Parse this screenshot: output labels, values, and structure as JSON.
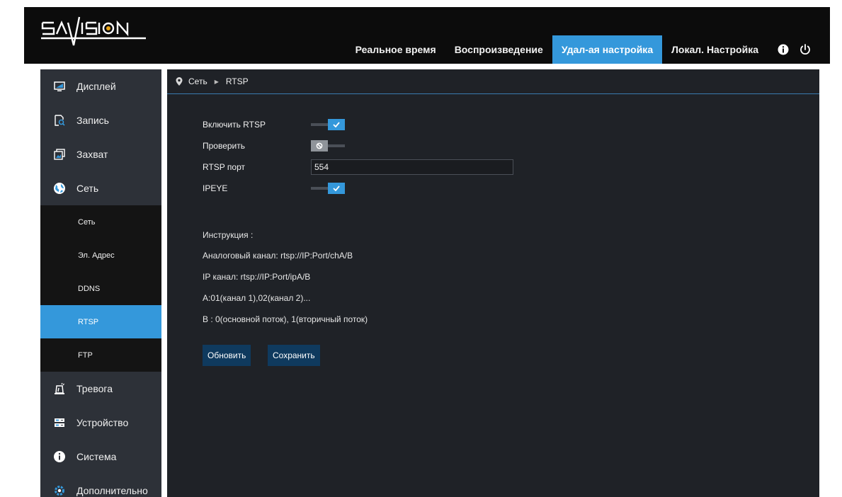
{
  "header": {
    "logo_text": "SATVISION",
    "tabs": [
      {
        "label": "Реальное время",
        "active": false
      },
      {
        "label": "Воспроизведение",
        "active": false
      },
      {
        "label": "Удал-ая настройка",
        "active": true
      },
      {
        "label": "Локал. Настройка",
        "active": false
      }
    ],
    "icons": [
      "info-icon",
      "power-icon"
    ]
  },
  "sidebar": {
    "items_top": [
      {
        "label": "Дисплей",
        "icon": "monitor-icon"
      },
      {
        "label": "Запись",
        "icon": "record-search-icon"
      },
      {
        "label": "Захват",
        "icon": "capture-icon"
      },
      {
        "label": "Сеть",
        "icon": "network-globe-icon"
      }
    ],
    "subitems": [
      {
        "label": "Сеть",
        "active": false
      },
      {
        "label": "Эл. Адрес",
        "active": false
      },
      {
        "label": "DDNS",
        "active": false
      },
      {
        "label": "RTSP",
        "active": true
      },
      {
        "label": "FTP",
        "active": false
      }
    ],
    "items_bottom": [
      {
        "label": "Тревога",
        "icon": "alarm-icon"
      },
      {
        "label": "Устройство",
        "icon": "device-icon"
      },
      {
        "label": "Система",
        "icon": "system-info-icon"
      },
      {
        "label": "Дополнительно",
        "icon": "advanced-gear-icon"
      }
    ]
  },
  "breadcrumb": {
    "icon": "location-pin-icon",
    "parts": [
      "Сеть",
      "RTSP"
    ]
  },
  "form": {
    "enable_rtsp": {
      "label": "Включить RTSP",
      "checked": true
    },
    "verify": {
      "label": "Проверить",
      "checked": false
    },
    "rtsp_port": {
      "label": "RTSP порт",
      "value": "554"
    },
    "ipeye": {
      "label": "IPEYE",
      "checked": true
    }
  },
  "instructions": {
    "title": "Инструкция :",
    "lines": [
      "Аналоговый канал: rtsp://IP:Port/chA/B",
      "IP канал: rtsp://IP:Port/ipA/B",
      "A:01(канал 1),02(канал 2)...",
      "B : 0(основной поток), 1(вторичный поток)"
    ]
  },
  "buttons": {
    "refresh": "Обновить",
    "save": "Сохранить"
  },
  "colors": {
    "accent": "#3498db",
    "header_bg": "#0c0c0c",
    "sidebar_bg": "#2d3138",
    "main_bg": "#1f2227",
    "button_bg": "#0f3a5e"
  }
}
